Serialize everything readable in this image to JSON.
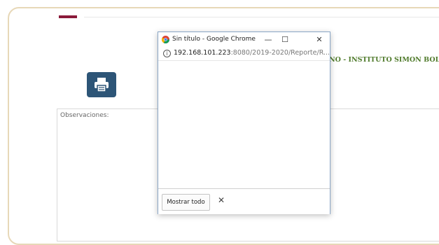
{
  "page": {
    "institution_name": "NO - INSTITUTO SIMON BOLIVAR",
    "observations_label": "Observaciones:"
  },
  "popup": {
    "title": "Sin título - Google Chrome",
    "controls": {
      "minimize": "—",
      "maximize": "☐",
      "close": "✕"
    },
    "info_icon": "i",
    "url_host": "192.168.101.223",
    "url_rest": ":8080/2019-2020/Reporte/R...",
    "show_all_label": "Mostrar todo",
    "dismiss": "✕"
  },
  "colors": {
    "accent": "#8b1a3a",
    "print_button": "#2d5577",
    "institution_text": "#4f7a2b",
    "frame_border": "#e7d8b8"
  }
}
